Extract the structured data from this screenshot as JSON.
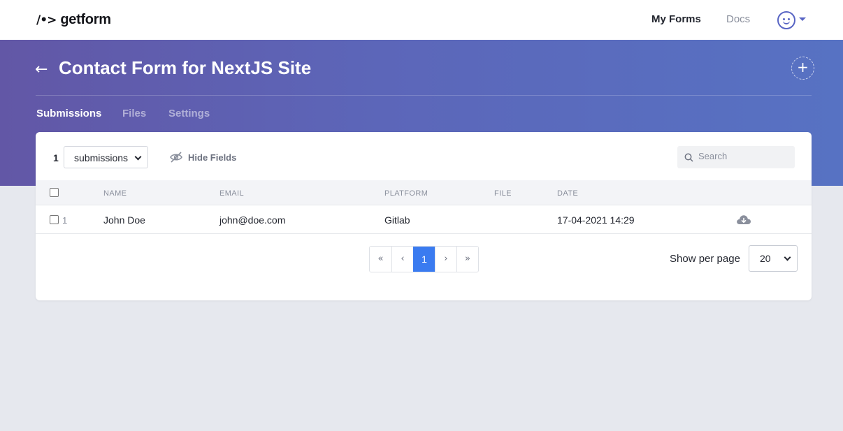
{
  "brand": {
    "mark": "/•>",
    "name": "getform"
  },
  "nav": {
    "my_forms": "My Forms",
    "docs": "Docs"
  },
  "header": {
    "back_icon": "←",
    "title": "Contact Form for NextJS Site",
    "add_icon": "+"
  },
  "tabs": [
    {
      "label": "Submissions",
      "active": true
    },
    {
      "label": "Files",
      "active": false
    },
    {
      "label": "Settings",
      "active": false
    }
  ],
  "toolbar": {
    "count": "1",
    "view_select": "submissions",
    "hide_fields": "Hide Fields",
    "search_placeholder": "Search"
  },
  "table": {
    "columns": [
      "NAME",
      "EMAIL",
      "PLATFORM",
      "FILE",
      "DATE"
    ],
    "rows": [
      {
        "index": "1",
        "name": "John Doe",
        "email": "john@doe.com",
        "platform": "Gitlab",
        "file": "",
        "date": "17-04-2021 14:29"
      }
    ]
  },
  "pagination": {
    "first": "«",
    "prev": "‹",
    "current": "1",
    "next": "›",
    "last": "»"
  },
  "per_page": {
    "label": "Show per page",
    "value": "20"
  },
  "colors": {
    "accent": "#3a7bf0",
    "hero_start": "#6257a6",
    "hero_end": "#5772c3",
    "avatar": "#5865c4"
  }
}
